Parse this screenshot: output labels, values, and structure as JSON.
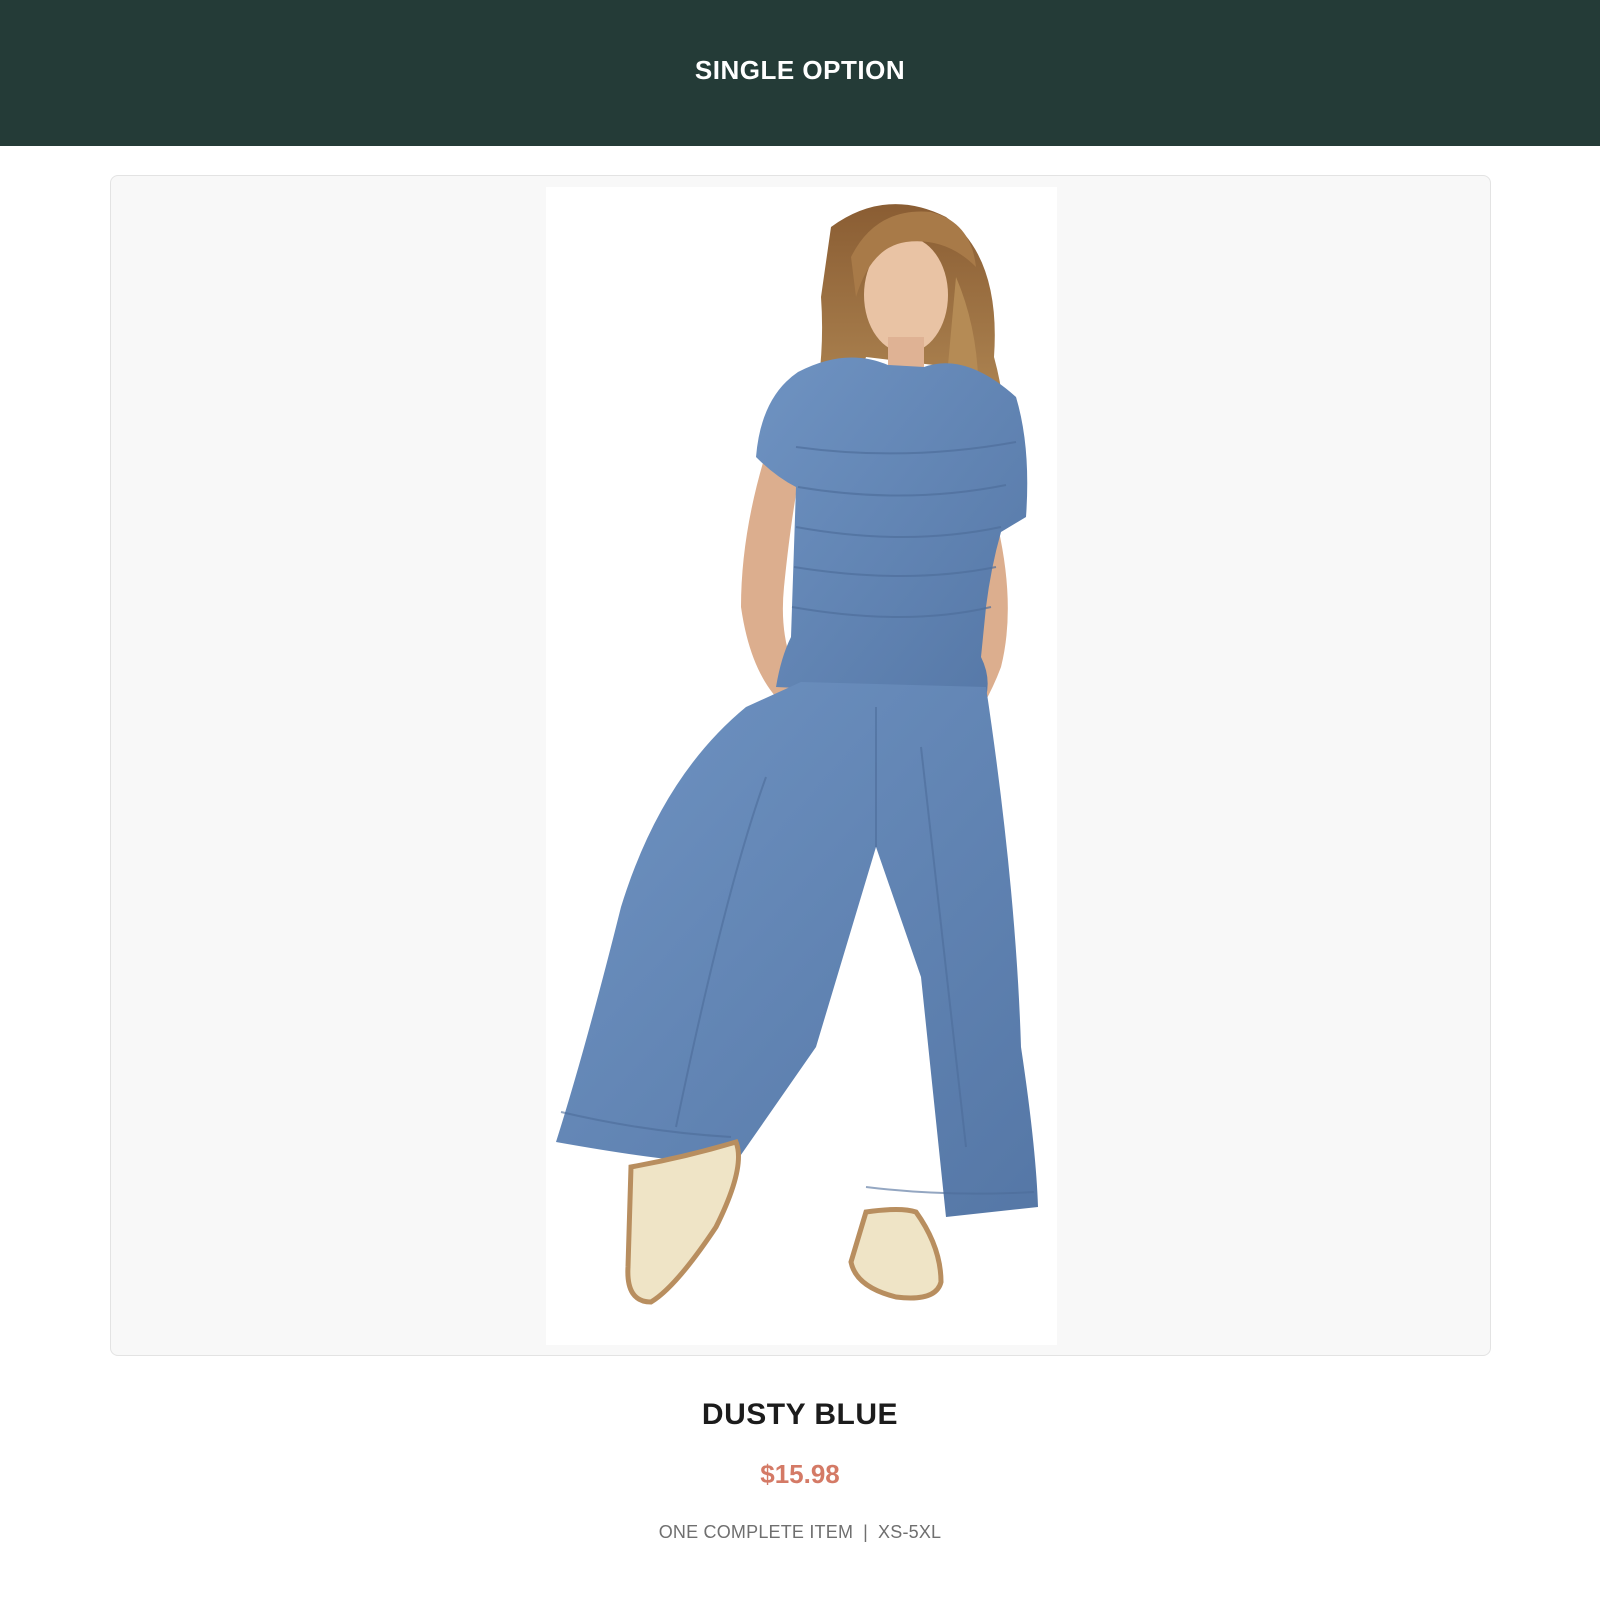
{
  "header": {
    "title": "SINGLE OPTION",
    "background_color": "#243b37"
  },
  "product": {
    "image_icon": "product-photo-model-dusty-blue-set",
    "name": "DUSTY BLUE",
    "price": "$15.98",
    "price_color": "#d47a66",
    "meta_left": "ONE COMPLETE ITEM",
    "meta_separator": "|",
    "meta_right": "XS-5XL"
  }
}
